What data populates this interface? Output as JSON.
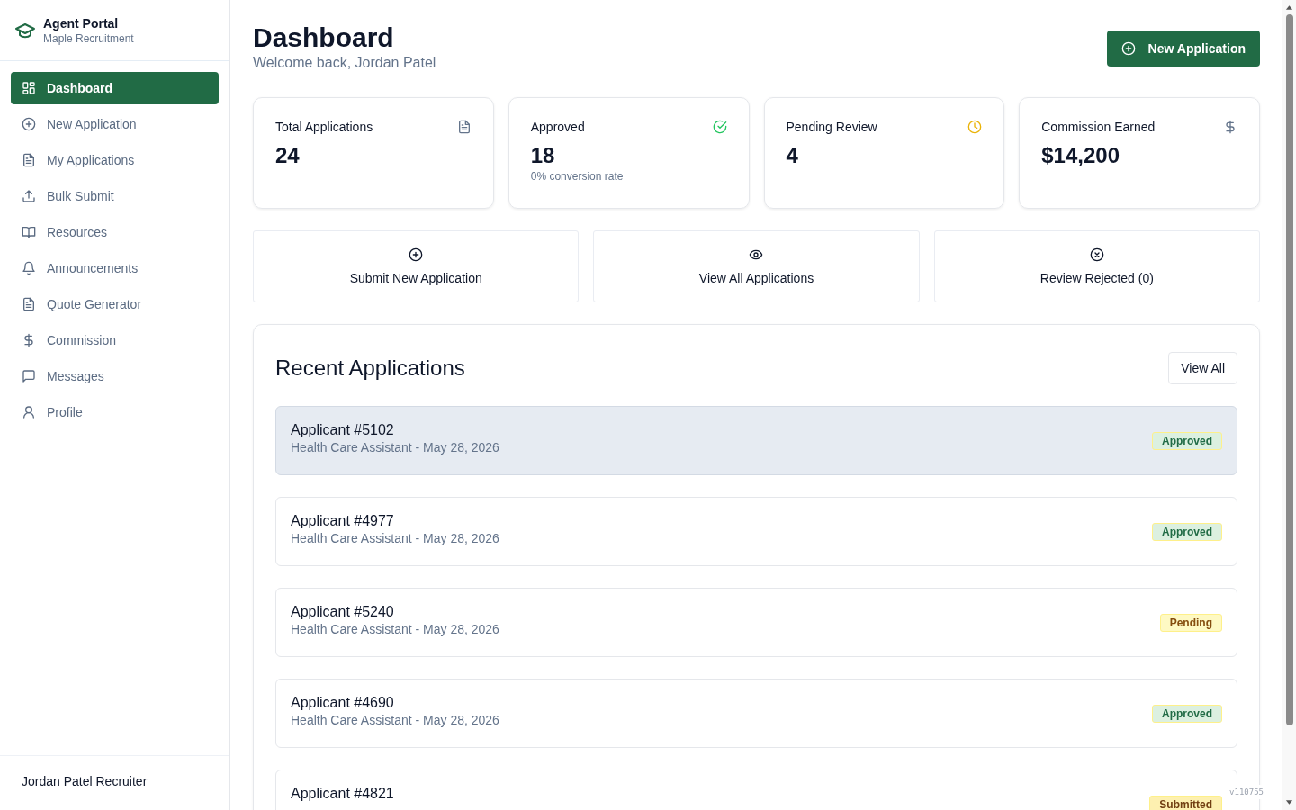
{
  "sidebar": {
    "title": "Agent Portal",
    "subtitle": "Maple Recruitment",
    "items": [
      {
        "label": "Dashboard",
        "selected": true
      },
      {
        "label": "New Application",
        "selected": false
      },
      {
        "label": "My Applications",
        "selected": false
      },
      {
        "label": "Bulk Submit",
        "selected": false
      },
      {
        "label": "Resources",
        "selected": false
      },
      {
        "label": "Announcements",
        "selected": false
      },
      {
        "label": "Quote Generator",
        "selected": false
      },
      {
        "label": "Commission",
        "selected": false
      },
      {
        "label": "Messages",
        "selected": false
      },
      {
        "label": "Profile",
        "selected": false
      }
    ],
    "user": "Jordan Patel Recruiter"
  },
  "header": {
    "title": "Dashboard",
    "subtitle": "Welcome back, Jordan Patel",
    "action": "New Application"
  },
  "stats": [
    {
      "label": "Total Applications",
      "value": "24"
    },
    {
      "label": "Approved",
      "value": "18",
      "note": "0% conversion rate"
    },
    {
      "label": "Pending Review",
      "value": "4"
    },
    {
      "label": "Commission Earned",
      "value": "$14,200"
    }
  ],
  "actions": [
    {
      "label": "Submit New Application"
    },
    {
      "label": "View All Applications"
    },
    {
      "label": "Review Rejected (0)"
    }
  ],
  "recent": {
    "title": "Recent Applications",
    "button": "View All",
    "rows": [
      {
        "name": "Applicant #5102",
        "detail": "Health Care Assistant - May 28, 2026",
        "status": "Approved",
        "kind": "approved",
        "highlighted": true
      },
      {
        "name": "Applicant #4977",
        "detail": "Health Care Assistant - May 28, 2026",
        "status": "Approved",
        "kind": "approved",
        "highlighted": false
      },
      {
        "name": "Applicant #5240",
        "detail": "Health Care Assistant - May 28, 2026",
        "status": "Pending",
        "kind": "pending",
        "highlighted": false
      },
      {
        "name": "Applicant #4690",
        "detail": "Health Care Assistant - May 28, 2026",
        "status": "Approved",
        "kind": "approved",
        "highlighted": false
      },
      {
        "name": "Applicant #4821",
        "status": "Submitted",
        "kind": "submitted",
        "highlighted": false
      }
    ]
  },
  "version": "v110755"
}
